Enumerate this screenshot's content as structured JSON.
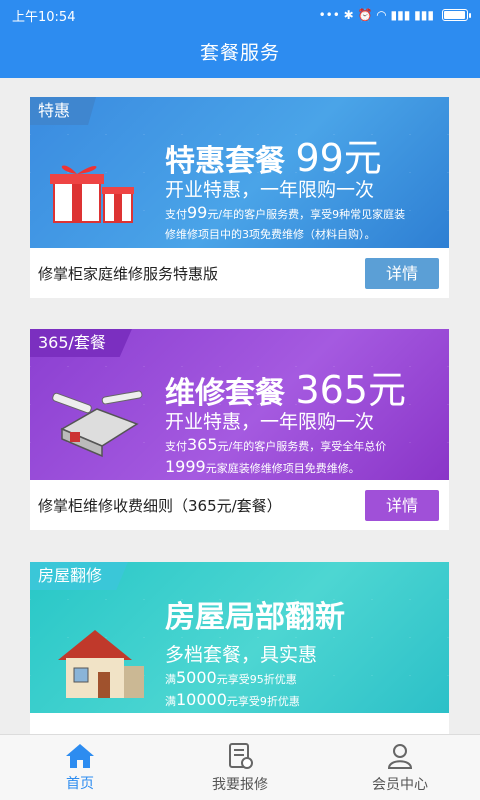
{
  "status": {
    "time": "上午10:54",
    "icons_text": "••• ✱ ⏰ ◠ ▮▮▮ ▮▮▮",
    "battery_level": 0.9
  },
  "header": {
    "title": "套餐服务"
  },
  "cards": [
    {
      "tag": "特惠",
      "headline": "特惠套餐",
      "price": "99元",
      "subline": "开业特惠，一年限购一次",
      "desc_line1_pre": "支付",
      "desc_line1_num": "99",
      "desc_line1_post": "元/年的客户服务费，享受9种常见家庭装",
      "desc_line2": "修维修项目中的3项免费维修（材料自购）。",
      "footer_text": "修掌柜家庭维修服务特惠版",
      "button": "详情",
      "accent": "#5b9fd6"
    },
    {
      "tag": "365/套餐",
      "headline": "维修套餐",
      "price": "365元",
      "subline": "开业特惠，一年限购一次",
      "desc_line1_pre": "支付",
      "desc_line1_num": "365",
      "desc_line1_post": "元/年的客户服务费，享受全年总价",
      "desc_line2_num": "1999",
      "desc_line2": "元家庭装修维修项目免费维修。",
      "footer_text": "修掌柜维修收费细则（365元/套餐）",
      "button": "详情",
      "accent": "#a050d8"
    },
    {
      "tag": "房屋翻修",
      "headline": "房屋局部翻新",
      "subline": "多档套餐，具实惠",
      "desc_line1_pre": "满",
      "desc_line1_num": "5000",
      "desc_line1_post": "元享受95折优惠",
      "desc_line2_pre": "满",
      "desc_line2_num": "10000",
      "desc_line2": "元享受9折优惠"
    }
  ],
  "nav": [
    {
      "label": "首页",
      "icon": "home-icon",
      "active": true
    },
    {
      "label": "我要报修",
      "icon": "repair-form-icon",
      "active": false
    },
    {
      "label": "会员中心",
      "icon": "user-icon",
      "active": false
    }
  ],
  "colors": {
    "primary": "#2d8cf0",
    "background": "#eeeeee"
  }
}
